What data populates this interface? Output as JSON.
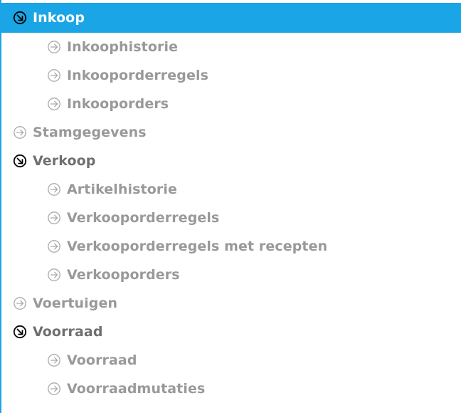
{
  "tree": {
    "nodes": [
      {
        "label": "Inkoop",
        "level": 0,
        "state": "expanded",
        "selected": true,
        "icon": "expanded-arrow-icon"
      },
      {
        "label": "Inkoophistorie",
        "level": 1,
        "state": "collapsed",
        "selected": false,
        "icon": "collapsed-arrow-icon"
      },
      {
        "label": "Inkooporderregels",
        "level": 1,
        "state": "collapsed",
        "selected": false,
        "icon": "collapsed-arrow-icon"
      },
      {
        "label": "Inkooporders",
        "level": 1,
        "state": "collapsed",
        "selected": false,
        "icon": "collapsed-arrow-icon"
      },
      {
        "label": "Stamgegevens",
        "level": 0,
        "state": "collapsed",
        "selected": false,
        "icon": "collapsed-arrow-icon"
      },
      {
        "label": "Verkoop",
        "level": 0,
        "state": "expanded",
        "selected": false,
        "icon": "expanded-arrow-icon"
      },
      {
        "label": "Artikelhistorie",
        "level": 1,
        "state": "collapsed",
        "selected": false,
        "icon": "collapsed-arrow-icon"
      },
      {
        "label": "Verkooporderregels",
        "level": 1,
        "state": "collapsed",
        "selected": false,
        "icon": "collapsed-arrow-icon"
      },
      {
        "label": "Verkooporderregels met recepten",
        "level": 1,
        "state": "collapsed",
        "selected": false,
        "icon": "collapsed-arrow-icon"
      },
      {
        "label": "Verkooporders",
        "level": 1,
        "state": "collapsed",
        "selected": false,
        "icon": "collapsed-arrow-icon"
      },
      {
        "label": "Voertuigen",
        "level": 0,
        "state": "collapsed",
        "selected": false,
        "icon": "collapsed-arrow-icon"
      },
      {
        "label": "Voorraad",
        "level": 0,
        "state": "expanded",
        "selected": false,
        "icon": "expanded-arrow-icon"
      },
      {
        "label": "Voorraad",
        "level": 1,
        "state": "collapsed",
        "selected": false,
        "icon": "collapsed-arrow-icon"
      },
      {
        "label": "Voorraadmutaties",
        "level": 1,
        "state": "collapsed",
        "selected": false,
        "icon": "collapsed-arrow-icon"
      }
    ]
  },
  "colors": {
    "accent": "#1aa5e6",
    "text_collapsed": "#999999",
    "text_expanded": "#6f6f6f",
    "text_selected": "#ffffff",
    "icon_collapsed": "#aaaaaa",
    "icon_expanded": "#000000"
  }
}
